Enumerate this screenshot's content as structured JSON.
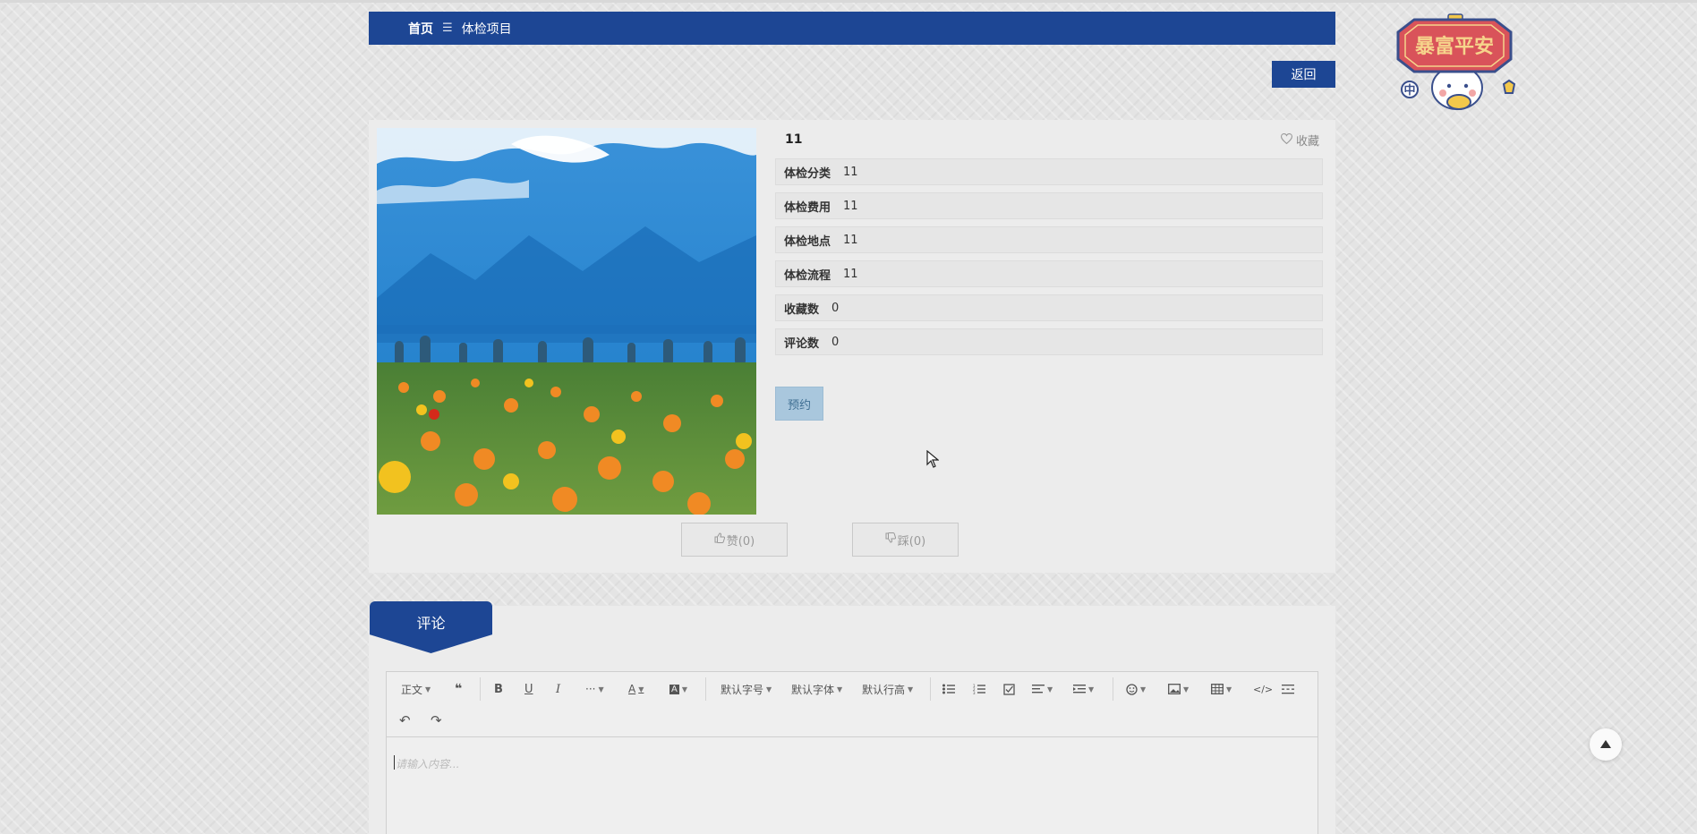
{
  "breadcrumb": {
    "home": "首页",
    "separator": "☰",
    "current": "体检项目"
  },
  "back_button": "返回",
  "sticker": {
    "text": "暴富平安",
    "left_char": "中"
  },
  "detail": {
    "title": "11",
    "favorite_label": "收藏",
    "rows": [
      {
        "label": "体检分类",
        "value": "11"
      },
      {
        "label": "体检费用",
        "value": "11"
      },
      {
        "label": "体检地点",
        "value": "11"
      },
      {
        "label": "体检流程",
        "value": "11"
      },
      {
        "label": "收藏数",
        "value": "0"
      },
      {
        "label": "评论数",
        "value": "0"
      }
    ],
    "reserve_button": "预约",
    "like_label": "赞(0)",
    "dislike_label": "踩(0)"
  },
  "comments": {
    "tab_label": "评论",
    "toolbar": {
      "paragraph": "正文",
      "font_size": "默认字号",
      "font_family": "默认字体",
      "line_height": "默认行高"
    },
    "placeholder": "请输入内容..."
  },
  "icons": {
    "favorite": "heart-outline-icon",
    "like": "thumbs-up-icon",
    "dislike": "thumbs-down-icon",
    "back_to_top": "arrow-up-icon"
  },
  "colors": {
    "primary": "#1d4694",
    "reserve_button": "#a9c7dd"
  }
}
